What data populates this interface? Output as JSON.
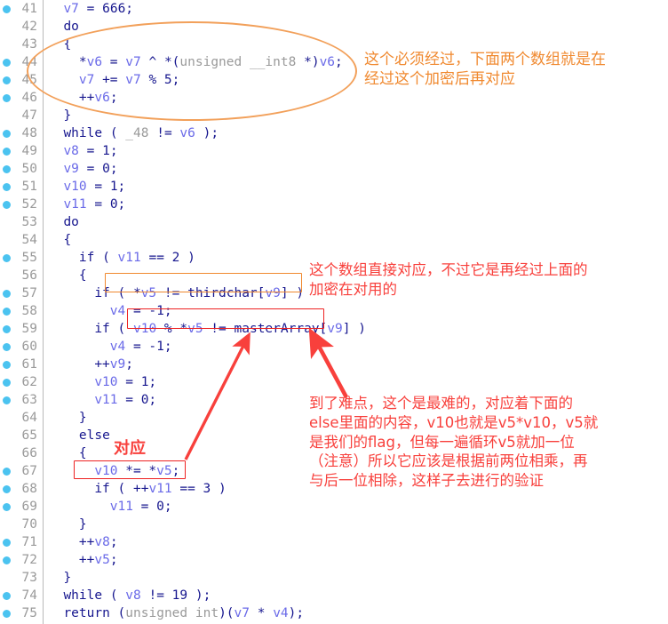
{
  "editor": {
    "type": "decompiler-pseudocode-view",
    "gutter_marker_icon": "breakpoint-dot-icon",
    "first_line_number": 41,
    "last_line_number": 75,
    "lines": [
      {
        "n": 41,
        "marker": true,
        "indent": 2,
        "tokens": [
          {
            "t": "v7",
            "c": "v"
          },
          {
            "t": " = ",
            "c": "k"
          },
          {
            "t": "666;",
            "c": "k"
          }
        ]
      },
      {
        "n": 42,
        "marker": false,
        "indent": 2,
        "tokens": [
          {
            "t": "do",
            "c": "k"
          }
        ]
      },
      {
        "n": 43,
        "marker": false,
        "indent": 2,
        "tokens": [
          {
            "t": "{",
            "c": "k"
          }
        ]
      },
      {
        "n": 44,
        "marker": true,
        "indent": 4,
        "tokens": [
          {
            "t": "*",
            "c": "k"
          },
          {
            "t": "v6",
            "c": "v"
          },
          {
            "t": " = ",
            "c": "k"
          },
          {
            "t": "v7",
            "c": "v"
          },
          {
            "t": " ^ *(",
            "c": "k"
          },
          {
            "t": "unsigned __int8",
            "c": "t"
          },
          {
            "t": " *)",
            "c": "k"
          },
          {
            "t": "v6",
            "c": "v"
          },
          {
            "t": ";",
            "c": "k"
          }
        ]
      },
      {
        "n": 45,
        "marker": true,
        "indent": 4,
        "tokens": [
          {
            "t": "v7",
            "c": "v"
          },
          {
            "t": " += ",
            "c": "k"
          },
          {
            "t": "v7",
            "c": "v"
          },
          {
            "t": " % 5;",
            "c": "k"
          }
        ]
      },
      {
        "n": 46,
        "marker": true,
        "indent": 4,
        "tokens": [
          {
            "t": "++",
            "c": "k"
          },
          {
            "t": "v6",
            "c": "v"
          },
          {
            "t": ";",
            "c": "k"
          }
        ]
      },
      {
        "n": 47,
        "marker": false,
        "indent": 2,
        "tokens": [
          {
            "t": "}",
            "c": "k"
          }
        ]
      },
      {
        "n": 48,
        "marker": true,
        "indent": 2,
        "tokens": [
          {
            "t": "while",
            "c": "k"
          },
          {
            "t": " ( ",
            "c": "k"
          },
          {
            "t": "_48",
            "c": "t"
          },
          {
            "t": " != ",
            "c": "k"
          },
          {
            "t": "v6",
            "c": "v"
          },
          {
            "t": " );",
            "c": "k"
          }
        ]
      },
      {
        "n": 49,
        "marker": true,
        "indent": 2,
        "tokens": [
          {
            "t": "v8",
            "c": "v"
          },
          {
            "t": " = 1;",
            "c": "k"
          }
        ]
      },
      {
        "n": 50,
        "marker": true,
        "indent": 2,
        "tokens": [
          {
            "t": "v9",
            "c": "v"
          },
          {
            "t": " = 0;",
            "c": "k"
          }
        ]
      },
      {
        "n": 51,
        "marker": true,
        "indent": 2,
        "tokens": [
          {
            "t": "v10",
            "c": "v"
          },
          {
            "t": " = 1;",
            "c": "k"
          }
        ]
      },
      {
        "n": 52,
        "marker": true,
        "indent": 2,
        "tokens": [
          {
            "t": "v11",
            "c": "v"
          },
          {
            "t": " = 0;",
            "c": "k"
          }
        ]
      },
      {
        "n": 53,
        "marker": false,
        "indent": 2,
        "tokens": [
          {
            "t": "do",
            "c": "k"
          }
        ]
      },
      {
        "n": 54,
        "marker": false,
        "indent": 2,
        "tokens": [
          {
            "t": "{",
            "c": "k"
          }
        ]
      },
      {
        "n": 55,
        "marker": true,
        "indent": 4,
        "tokens": [
          {
            "t": "if",
            "c": "k"
          },
          {
            "t": " ( ",
            "c": "k"
          },
          {
            "t": "v11",
            "c": "v"
          },
          {
            "t": " == 2 )",
            "c": "k"
          }
        ]
      },
      {
        "n": 56,
        "marker": false,
        "indent": 4,
        "tokens": [
          {
            "t": "{",
            "c": "k"
          }
        ]
      },
      {
        "n": 57,
        "marker": true,
        "indent": 6,
        "tokens": [
          {
            "t": "if",
            "c": "k"
          },
          {
            "t": " ( *",
            "c": "k"
          },
          {
            "t": "v5",
            "c": "v"
          },
          {
            "t": " != ",
            "c": "k"
          },
          {
            "t": "thirdchar",
            "c": "g"
          },
          {
            "t": "[",
            "c": "k"
          },
          {
            "t": "v9",
            "c": "v"
          },
          {
            "t": "] )",
            "c": "k"
          }
        ]
      },
      {
        "n": 58,
        "marker": true,
        "indent": 8,
        "tokens": [
          {
            "t": "v4",
            "c": "v"
          },
          {
            "t": " = -1;",
            "c": "k"
          }
        ]
      },
      {
        "n": 59,
        "marker": true,
        "indent": 6,
        "tokens": [
          {
            "t": "if",
            "c": "k"
          },
          {
            "t": " ( ",
            "c": "k"
          },
          {
            "t": "v10",
            "c": "v"
          },
          {
            "t": " % *",
            "c": "k"
          },
          {
            "t": "v5",
            "c": "v"
          },
          {
            "t": " != ",
            "c": "k"
          },
          {
            "t": "masterArray",
            "c": "g"
          },
          {
            "t": "[",
            "c": "k"
          },
          {
            "t": "v9",
            "c": "v"
          },
          {
            "t": "] )",
            "c": "k"
          }
        ]
      },
      {
        "n": 60,
        "marker": true,
        "indent": 8,
        "tokens": [
          {
            "t": "v4",
            "c": "v"
          },
          {
            "t": " = -1;",
            "c": "k"
          }
        ]
      },
      {
        "n": 61,
        "marker": true,
        "indent": 6,
        "tokens": [
          {
            "t": "++",
            "c": "k"
          },
          {
            "t": "v9",
            "c": "v"
          },
          {
            "t": ";",
            "c": "k"
          }
        ]
      },
      {
        "n": 62,
        "marker": true,
        "indent": 6,
        "tokens": [
          {
            "t": "v10",
            "c": "v"
          },
          {
            "t": " = 1;",
            "c": "k"
          }
        ]
      },
      {
        "n": 63,
        "marker": true,
        "indent": 6,
        "tokens": [
          {
            "t": "v11",
            "c": "v"
          },
          {
            "t": " = 0;",
            "c": "k"
          }
        ]
      },
      {
        "n": 64,
        "marker": false,
        "indent": 4,
        "tokens": [
          {
            "t": "}",
            "c": "k"
          }
        ]
      },
      {
        "n": 65,
        "marker": false,
        "indent": 4,
        "tokens": [
          {
            "t": "else",
            "c": "k"
          }
        ]
      },
      {
        "n": 66,
        "marker": false,
        "indent": 4,
        "tokens": [
          {
            "t": "{",
            "c": "k"
          }
        ]
      },
      {
        "n": 67,
        "marker": true,
        "indent": 6,
        "tokens": [
          {
            "t": "v10",
            "c": "v"
          },
          {
            "t": " *= *",
            "c": "k"
          },
          {
            "t": "v5",
            "c": "v"
          },
          {
            "t": ";",
            "c": "k"
          }
        ]
      },
      {
        "n": 68,
        "marker": true,
        "indent": 6,
        "tokens": [
          {
            "t": "if",
            "c": "k"
          },
          {
            "t": " ( ++",
            "c": "k"
          },
          {
            "t": "v11",
            "c": "v"
          },
          {
            "t": " == 3 )",
            "c": "k"
          }
        ]
      },
      {
        "n": 69,
        "marker": true,
        "indent": 8,
        "tokens": [
          {
            "t": "v11",
            "c": "v"
          },
          {
            "t": " = 0;",
            "c": "k"
          }
        ]
      },
      {
        "n": 70,
        "marker": false,
        "indent": 4,
        "tokens": [
          {
            "t": "}",
            "c": "k"
          }
        ]
      },
      {
        "n": 71,
        "marker": true,
        "indent": 4,
        "tokens": [
          {
            "t": "++",
            "c": "k"
          },
          {
            "t": "v8",
            "c": "v"
          },
          {
            "t": ";",
            "c": "k"
          }
        ]
      },
      {
        "n": 72,
        "marker": true,
        "indent": 4,
        "tokens": [
          {
            "t": "++",
            "c": "k"
          },
          {
            "t": "v5",
            "c": "v"
          },
          {
            "t": ";",
            "c": "k"
          }
        ]
      },
      {
        "n": 73,
        "marker": false,
        "indent": 2,
        "tokens": [
          {
            "t": "}",
            "c": "k"
          }
        ]
      },
      {
        "n": 74,
        "marker": true,
        "indent": 2,
        "tokens": [
          {
            "t": "while",
            "c": "k"
          },
          {
            "t": " ( ",
            "c": "k"
          },
          {
            "t": "v8",
            "c": "v"
          },
          {
            "t": " != 19 );",
            "c": "k"
          }
        ]
      },
      {
        "n": 75,
        "marker": true,
        "indent": 2,
        "tokens": [
          {
            "t": "return",
            "c": "k"
          },
          {
            "t": " (",
            "c": "k"
          },
          {
            "t": "unsigned int",
            "c": "t"
          },
          {
            "t": ")(",
            "c": "k"
          },
          {
            "t": "v7",
            "c": "v"
          },
          {
            "t": " * ",
            "c": "k"
          },
          {
            "t": "v4",
            "c": "v"
          },
          {
            "t": ");",
            "c": "k"
          }
        ]
      }
    ]
  },
  "annotations": {
    "colors": {
      "orange": "#f0892f",
      "ellipse_orange": "#f2a05a",
      "red": "#f8403c",
      "red_box": "#ee2222",
      "breakpoint_blue": "#4bc3f0",
      "lineno_grey": "#9a9a9a",
      "code_blue": "#16168e",
      "variable_blue": "#6a6ae8",
      "type_grey": "#9a9a9a"
    },
    "ellipse_note": {
      "shape": "ellipse",
      "target_lines": "42-47",
      "color": "#f2a05a"
    },
    "orange_note_top": {
      "text": "这个必须经过，下面两个数组就是在\n经过这个加密后再对应",
      "color": "#f0892f"
    },
    "orange_box_line57": {
      "shape": "rectangle",
      "target_line": 57,
      "target_text": "( *v5 != thirdchar[v9] )",
      "color": "#f0892f"
    },
    "red_note_thirdchar": {
      "text": "这个数组直接对应，不过它是再经过上面的\n加密在对用的",
      "color": "#f8403c"
    },
    "red_box_line59": {
      "shape": "rectangle",
      "target_line": 59,
      "target_text": "v10 % *v5 != masterArray[v9]",
      "color": "#ee2222"
    },
    "red_note_hard": {
      "text": "到了难点，这个是最难的，对应着下面的\nelse里面的内容，v10也就是v5*v10，v5就\n是我们的flag，但每一遍循环v5就加一位\n（注意）所以它应该是根据前两位相乘，再\n与后一位相除，这样子去进行的验证",
      "color": "#f8403c"
    },
    "red_label_correspond": {
      "text": "对应",
      "color": "#f8403c"
    },
    "red_box_line67": {
      "shape": "rectangle",
      "target_line": 67,
      "target_text": "v10 *= *v5;",
      "color": "#ee2222"
    },
    "arrow_to_masterarray": {
      "icon": "arrow-up-right-icon",
      "color": "#f8403c"
    },
    "arrow_to_masterarray_right": {
      "icon": "arrow-up-left-icon",
      "color": "#f8403c"
    }
  }
}
